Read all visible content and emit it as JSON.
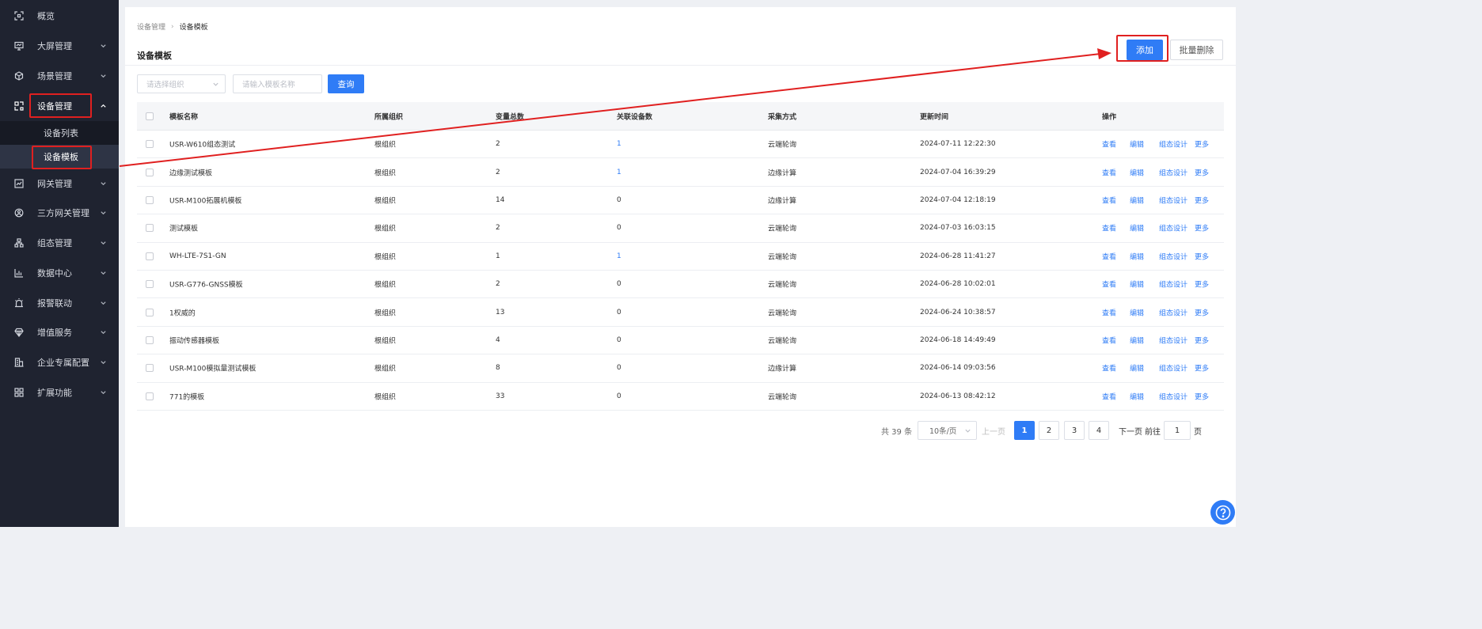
{
  "sidebar": {
    "items": [
      {
        "label": "概览",
        "icon": "overview-icon",
        "arrow": false
      },
      {
        "label": "大屏管理",
        "icon": "screen-icon",
        "arrow": true
      },
      {
        "label": "场景管理",
        "icon": "cube-icon",
        "arrow": true
      },
      {
        "label": "设备管理",
        "icon": "device-icon",
        "arrow": true,
        "expanded": true
      },
      {
        "label": "网关管理",
        "icon": "gateway-icon",
        "arrow": true
      },
      {
        "label": "三方网关管理",
        "icon": "third-party-icon",
        "arrow": true
      },
      {
        "label": "组态管理",
        "icon": "topology-icon",
        "arrow": true
      },
      {
        "label": "数据中心",
        "icon": "chart-icon",
        "arrow": true
      },
      {
        "label": "报警联动",
        "icon": "alarm-icon",
        "arrow": true
      },
      {
        "label": "增值服务",
        "icon": "diamond-icon",
        "arrow": true
      },
      {
        "label": "企业专属配置",
        "icon": "building-icon",
        "arrow": true
      },
      {
        "label": "扩展功能",
        "icon": "grid-icon",
        "arrow": true
      }
    ],
    "sub_items": [
      {
        "label": "设备列表",
        "active": false
      },
      {
        "label": "设备模板",
        "active": true
      }
    ]
  },
  "breadcrumb": {
    "parent": "设备管理",
    "current": "设备模板"
  },
  "page_title": "设备模板",
  "toolbar": {
    "add_label": "添加",
    "batch_delete_label": "批量删除"
  },
  "filters": {
    "org_placeholder": "请选择组织",
    "name_placeholder": "请输入模板名称",
    "query_label": "查询"
  },
  "table": {
    "headers": {
      "name": "模板名称",
      "org": "所属组织",
      "vars": "变量总数",
      "devices": "关联设备数",
      "mode": "采集方式",
      "time": "更新时间",
      "ops": "操作"
    },
    "row_actions": {
      "view": "查看",
      "edit": "编辑",
      "design": "组态设计",
      "more": "更多"
    },
    "rows": [
      {
        "name": "USR-W610组态测试",
        "org": "根组织",
        "vars": "2",
        "devices": "1",
        "devices_link": true,
        "mode": "云端轮询",
        "time": "2024-07-11 12:22:30"
      },
      {
        "name": "边缘测试模板",
        "org": "根组织",
        "vars": "2",
        "devices": "1",
        "devices_link": true,
        "mode": "边缘计算",
        "time": "2024-07-04 16:39:29"
      },
      {
        "name": "USR-M100拓展机模板",
        "org": "根组织",
        "vars": "14",
        "devices": "0",
        "devices_link": false,
        "mode": "边缘计算",
        "time": "2024-07-04 12:18:19"
      },
      {
        "name": "测试模板",
        "org": "根组织",
        "vars": "2",
        "devices": "0",
        "devices_link": false,
        "mode": "云端轮询",
        "time": "2024-07-03 16:03:15"
      },
      {
        "name": "WH-LTE-7S1-GN",
        "org": "根组织",
        "vars": "1",
        "devices": "1",
        "devices_link": true,
        "mode": "云端轮询",
        "time": "2024-06-28 11:41:27"
      },
      {
        "name": "USR-G776-GNSS模板",
        "org": "根组织",
        "vars": "2",
        "devices": "0",
        "devices_link": false,
        "mode": "云端轮询",
        "time": "2024-06-28 10:02:01"
      },
      {
        "name": "1权威的",
        "org": "根组织",
        "vars": "13",
        "devices": "0",
        "devices_link": false,
        "mode": "云端轮询",
        "time": "2024-06-24 10:38:57"
      },
      {
        "name": "振动传感器模板",
        "org": "根组织",
        "vars": "4",
        "devices": "0",
        "devices_link": false,
        "mode": "云端轮询",
        "time": "2024-06-18 14:49:49"
      },
      {
        "name": "USR-M100模拟量测试模板",
        "org": "根组织",
        "vars": "8",
        "devices": "0",
        "devices_link": false,
        "mode": "边缘计算",
        "time": "2024-06-14 09:03:56"
      },
      {
        "name": "771的模板",
        "org": "根组织",
        "vars": "33",
        "devices": "0",
        "devices_link": false,
        "mode": "云端轮询",
        "time": "2024-06-13 08:42:12"
      }
    ]
  },
  "pagination": {
    "total": "共 39 条",
    "page_size": "10条/页",
    "prev": "上一页",
    "pages": [
      "1",
      "2",
      "3",
      "4"
    ],
    "current_page": "1",
    "next": "下一页",
    "goto": "前往",
    "goto_value": "1",
    "unit": "页"
  },
  "colors": {
    "primary": "#2f7cf6",
    "sidebar_bg": "#1f2330",
    "highlight": "#e02020"
  }
}
